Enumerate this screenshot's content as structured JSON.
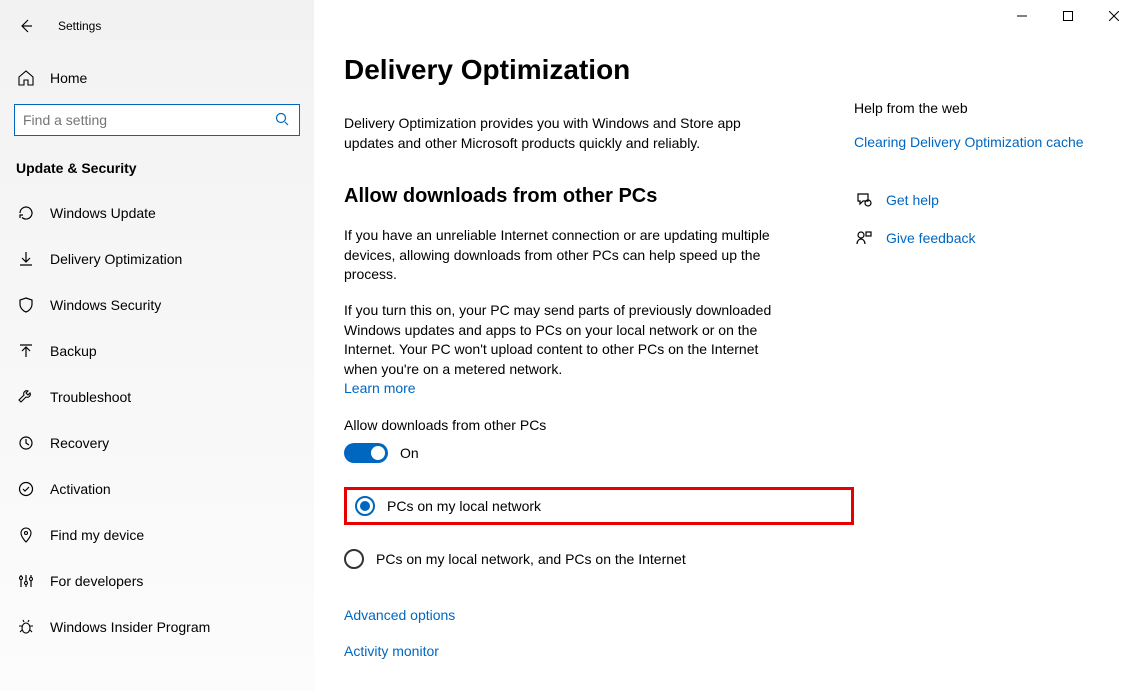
{
  "window": {
    "title": "Settings"
  },
  "sidebar": {
    "home_label": "Home",
    "search_placeholder": "Find a setting",
    "category": "Update & Security",
    "items": [
      {
        "label": "Windows Update"
      },
      {
        "label": "Delivery Optimization"
      },
      {
        "label": "Windows Security"
      },
      {
        "label": "Backup"
      },
      {
        "label": "Troubleshoot"
      },
      {
        "label": "Recovery"
      },
      {
        "label": "Activation"
      },
      {
        "label": "Find my device"
      },
      {
        "label": "For developers"
      },
      {
        "label": "Windows Insider Program"
      }
    ]
  },
  "main": {
    "title": "Delivery Optimization",
    "intro": "Delivery Optimization provides you with Windows and Store app updates and other Microsoft products quickly and reliably.",
    "section_heading": "Allow downloads from other PCs",
    "para1": "If you have an unreliable Internet connection or are updating multiple devices, allowing downloads from other PCs can help speed up the process.",
    "para2": "If you turn this on, your PC may send parts of previously downloaded Windows updates and apps to PCs on your local network or on the Internet. Your PC won't upload content to other PCs on the Internet when you're on a metered network.",
    "learn_more": "Learn more",
    "toggle_label": "Allow downloads from other PCs",
    "toggle_state": "On",
    "radio1": "PCs on my local network",
    "radio2": "PCs on my local network, and PCs on the Internet",
    "advanced": "Advanced options",
    "activity": "Activity monitor"
  },
  "right": {
    "help_heading": "Help from the web",
    "help_link": "Clearing Delivery Optimization cache",
    "get_help": "Get help",
    "give_feedback": "Give feedback"
  }
}
